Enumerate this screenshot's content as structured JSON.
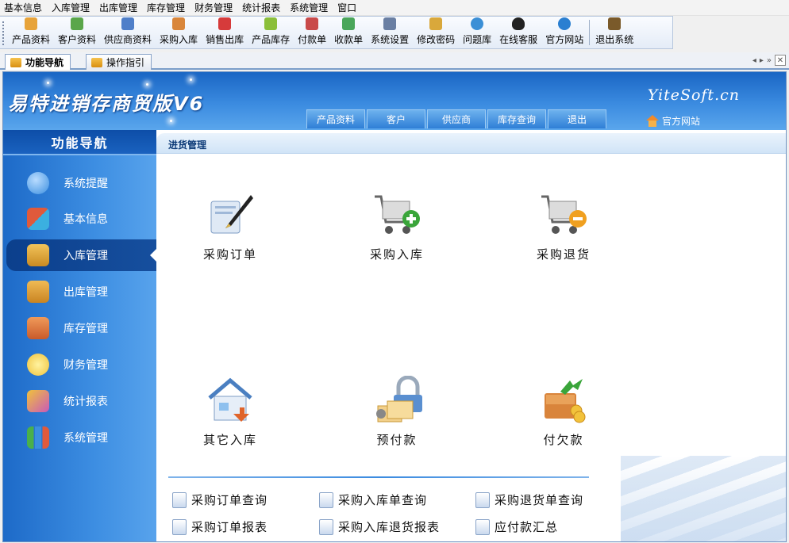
{
  "menubar": [
    "基本信息",
    "入库管理",
    "出库管理",
    "库存管理",
    "财务管理",
    "统计报表",
    "系统管理",
    "窗口"
  ],
  "toolbar": [
    {
      "label": "产品资料",
      "icon": "product-icon",
      "color": "#e7a33a"
    },
    {
      "label": "客户资料",
      "icon": "customer-icon",
      "color": "#5aa64a"
    },
    {
      "label": "供应商资料",
      "icon": "supplier-icon",
      "color": "#4f7fc9"
    },
    {
      "label": "采购入库",
      "icon": "purchase-in-icon",
      "color": "#d9863b"
    },
    {
      "label": "销售出库",
      "icon": "sales-out-icon",
      "color": "#d63b3b"
    },
    {
      "label": "产品库存",
      "icon": "inventory-icon",
      "color": "#8bbf3a"
    },
    {
      "label": "付款单",
      "icon": "payment-icon",
      "color": "#c94a4a"
    },
    {
      "label": "收款单",
      "icon": "receipt-icon",
      "color": "#4aa65a"
    },
    {
      "label": "系统设置",
      "icon": "settings-icon",
      "color": "#6a7fa3"
    },
    {
      "label": "修改密码",
      "icon": "password-icon",
      "color": "#d9a83b"
    },
    {
      "label": "问题库",
      "icon": "faq-icon",
      "color": "#3b8fd6"
    },
    {
      "label": "在线客服",
      "icon": "qq-icon",
      "color": "#222222"
    },
    {
      "label": "官方网站",
      "icon": "ie-icon",
      "color": "#2a7fd1"
    },
    {
      "label": "退出系统",
      "icon": "exit-icon",
      "color": "#7a5a2a"
    }
  ],
  "tabs": [
    {
      "label": "功能导航",
      "active": true
    },
    {
      "label": "操作指引",
      "active": false
    }
  ],
  "header": {
    "brand": "易特进销存商贸版V6",
    "site": "YiteSoft.cn",
    "nav": [
      "产品资料",
      "客户",
      "供应商",
      "库存查询",
      "退出"
    ],
    "home_link": "官方网站"
  },
  "sidebar": {
    "title": "功能导航",
    "items": [
      {
        "label": "系统提醒",
        "icon": "info-icon",
        "color": "#3b8fe0",
        "active": false
      },
      {
        "label": "基本信息",
        "icon": "cubes-icon",
        "color": "#e05a3b",
        "active": false
      },
      {
        "label": "入库管理",
        "icon": "box-in-icon",
        "color": "#e0a53b",
        "active": true
      },
      {
        "label": "出库管理",
        "icon": "box-out-icon",
        "color": "#d99a3b",
        "active": false
      },
      {
        "label": "库存管理",
        "icon": "warehouse-icon",
        "color": "#e07a4a",
        "active": false
      },
      {
        "label": "财务管理",
        "icon": "finance-icon",
        "color": "#f0c23b",
        "active": false
      },
      {
        "label": "统计报表",
        "icon": "report-icon",
        "color": "#c95ab8",
        "active": false
      },
      {
        "label": "系统管理",
        "icon": "chart-bars-icon",
        "color": "#4ab04a",
        "active": false
      }
    ]
  },
  "content": {
    "title": "进货管理",
    "functions": [
      {
        "label": "采购订单",
        "icon": "purchase-order-icon"
      },
      {
        "label": "采购入库",
        "icon": "cart-add-icon"
      },
      {
        "label": "采购退货",
        "icon": "cart-remove-icon"
      },
      {
        "label": "其它入库",
        "icon": "house-in-icon"
      },
      {
        "label": "预付款",
        "icon": "prepay-lock-icon"
      },
      {
        "label": "付欠款",
        "icon": "pay-debt-icon"
      }
    ],
    "reports": [
      {
        "label": "采购订单查询",
        "icon": "query-doc-icon"
      },
      {
        "label": "采购入库单查询",
        "icon": "query-doc-icon"
      },
      {
        "label": "采购退货单查询",
        "icon": "query-doc-icon"
      },
      {
        "label": "采购订单报表",
        "icon": "report-doc-icon"
      },
      {
        "label": "采购入库退货报表",
        "icon": "report-doc-icon"
      },
      {
        "label": "应付款汇总",
        "icon": "report-doc-icon"
      }
    ]
  }
}
